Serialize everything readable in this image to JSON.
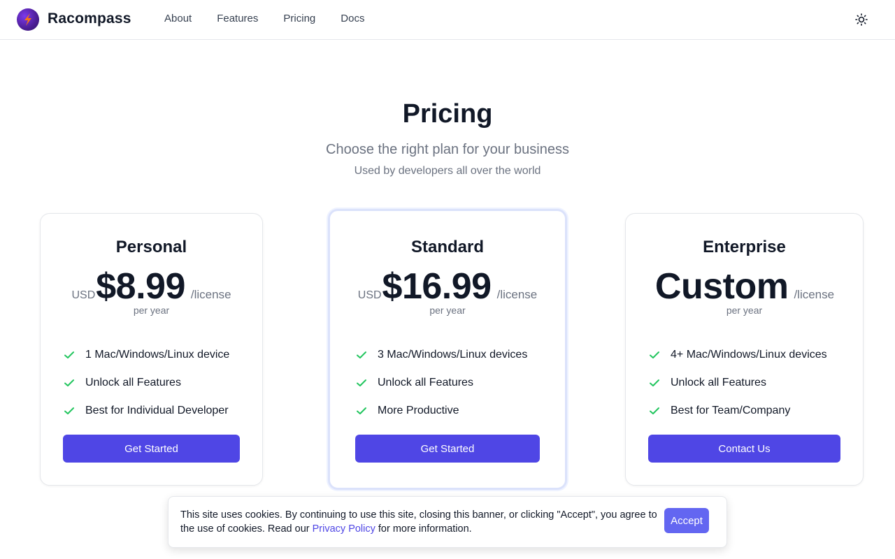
{
  "header": {
    "brand": "Racompass",
    "nav": [
      "About",
      "Features",
      "Pricing",
      "Docs"
    ],
    "theme_icon": "sun-icon"
  },
  "hero": {
    "title": "Pricing",
    "subtitle": "Choose the right plan for your business",
    "tagline": "Used by developers all over the world"
  },
  "plans": [
    {
      "name": "Personal",
      "currency": "USD",
      "price": "$8.99",
      "unit": "/license",
      "period": "per year",
      "features": [
        "1 Mac/Windows/Linux device",
        "Unlock all Features",
        "Best for Individual Developer"
      ],
      "cta": "Get Started"
    },
    {
      "name": "Standard",
      "currency": "USD",
      "price": "$16.99",
      "unit": "/license",
      "period": "per year",
      "features": [
        "3 Mac/Windows/Linux devices",
        "Unlock all Features",
        "More Productive"
      ],
      "cta": "Get Started"
    },
    {
      "name": "Enterprise",
      "currency": "",
      "price": "Custom",
      "unit": "/license",
      "period": "per year",
      "features": [
        "4+ Mac/Windows/Linux devices",
        "Unlock all Features",
        "Best for Team/Company"
      ],
      "cta": "Contact Us"
    }
  ],
  "cookie": {
    "text_before": "This site uses cookies. By continuing to use this site, closing this banner, or clicking \"Accept\", you agree to the use of cookies. Read our ",
    "link": "Privacy Policy",
    "text_after": " for more information.",
    "accept": "Accept"
  },
  "colors": {
    "accent": "#4f46e5",
    "check": "#22c55e",
    "text": "#111827",
    "muted": "#6b7280"
  }
}
